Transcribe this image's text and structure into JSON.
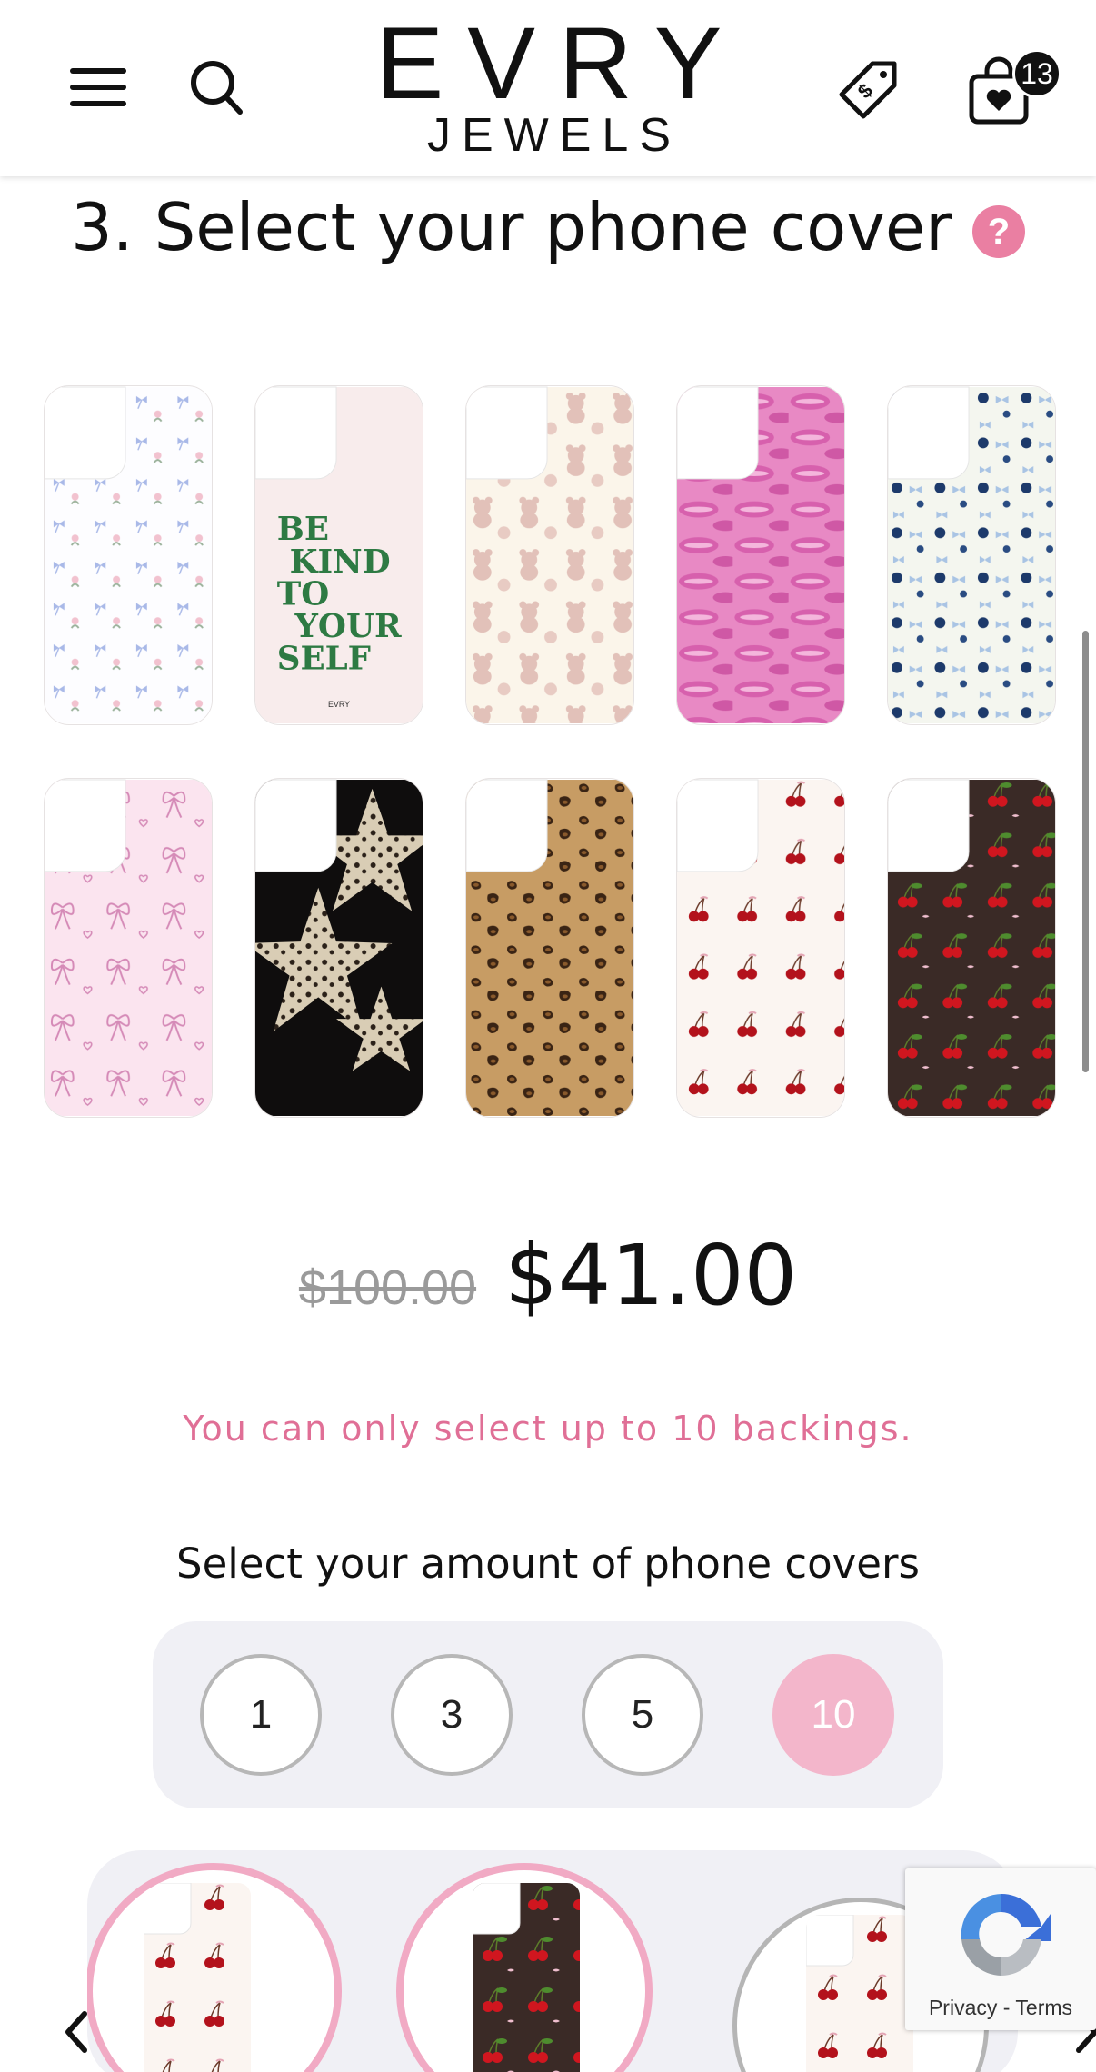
{
  "header": {
    "logo_main": "EVRY",
    "logo_sub": "JEWELS",
    "cart_count": "13",
    "icons": [
      "hamburger-menu-icon",
      "search-icon",
      "price-tag-icon",
      "shopping-bag-heart-icon"
    ]
  },
  "section": {
    "title": "3. Select your phone cover",
    "help": "?"
  },
  "covers": [
    {
      "name": "blue bows floral",
      "style": "bows-blue"
    },
    {
      "name": "be kind to yourself",
      "style": "be-kind",
      "text_lines": [
        "BE",
        "KIND",
        "TO",
        "YOUR",
        "SELF"
      ],
      "brand": "EVRY"
    },
    {
      "name": "teddy bears",
      "style": "bears"
    },
    {
      "name": "pink lips",
      "style": "lips"
    },
    {
      "name": "blue dots and bows",
      "style": "dots-bows"
    },
    {
      "name": "pink ribbon bows",
      "style": "pink-bows"
    },
    {
      "name": "leopard stars",
      "style": "leopard-stars"
    },
    {
      "name": "leopard print",
      "style": "leopard"
    },
    {
      "name": "cherries on cream",
      "style": "cherries-cream"
    },
    {
      "name": "cherries on dark",
      "style": "cherries-dark"
    }
  ],
  "price": {
    "original": "$100.00",
    "current": "$41.00"
  },
  "limit_message": "You can only select up to 10 backings.",
  "amount": {
    "label": "Select your amount of phone covers",
    "options": [
      "1",
      "3",
      "5",
      "10"
    ],
    "selected": "10"
  },
  "recaptcha": {
    "privacy": "Privacy",
    "separator": " - ",
    "terms": "Terms"
  },
  "colors": {
    "accent_pink": "#ea7fa2",
    "selected_pink": "#f3b6cb",
    "panel_gray": "#f0f0f5"
  }
}
